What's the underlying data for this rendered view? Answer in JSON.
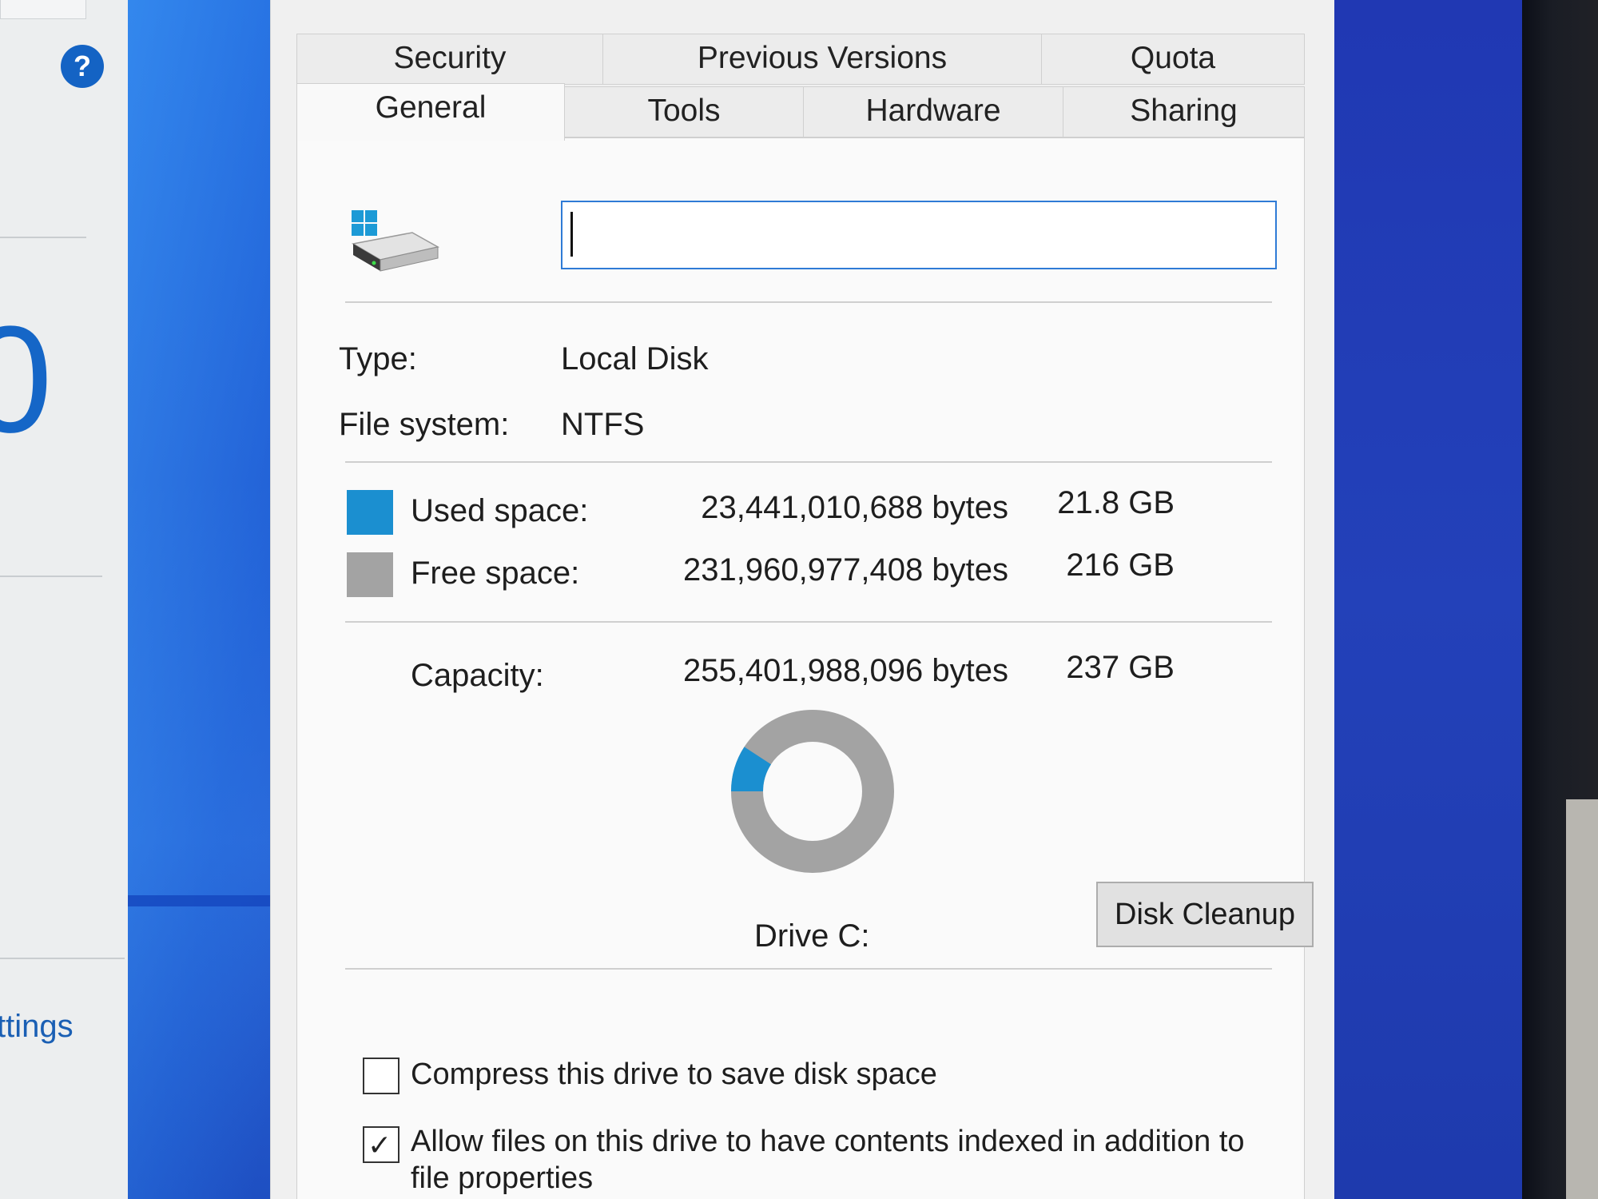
{
  "background_window": {
    "settings_link_text": "ttings",
    "large_glyph": "0",
    "help_icon_label": "?"
  },
  "dialog": {
    "tabs_row1": [
      {
        "label": "Security"
      },
      {
        "label": "Previous Versions"
      },
      {
        "label": "Quota"
      }
    ],
    "tabs_row2": [
      {
        "label": "General",
        "active": true
      },
      {
        "label": "Tools"
      },
      {
        "label": "Hardware"
      },
      {
        "label": "Sharing"
      }
    ],
    "drive_name_input": {
      "value": "",
      "placeholder": ""
    },
    "type_label": "Type:",
    "type_value": "Local Disk",
    "filesystem_label": "File system:",
    "filesystem_value": "NTFS",
    "used": {
      "label": "Used space:",
      "bytes": "23,441,010,688 bytes",
      "size": "21.8 GB",
      "color": "#1b8fd0"
    },
    "free": {
      "label": "Free space:",
      "bytes": "231,960,977,408 bytes",
      "size": "216 GB",
      "color": "#a3a3a3"
    },
    "capacity": {
      "label": "Capacity:",
      "bytes": "255,401,988,096 bytes",
      "size": "237 GB"
    },
    "usage_fraction": 0.0918,
    "drive_label": "Drive C:",
    "disk_cleanup_label": "Disk Cleanup",
    "compress_label": "Compress this drive to save disk space",
    "compress_checked": false,
    "index_label_line1": "Allow files on this drive to have contents indexed in addition to",
    "index_label_line2": "file properties",
    "index_checked": true
  },
  "colors": {
    "accent_blue": "#1463c4",
    "input_border": "#2f7bd6",
    "wallpaper_blue": "#1f56cf"
  }
}
